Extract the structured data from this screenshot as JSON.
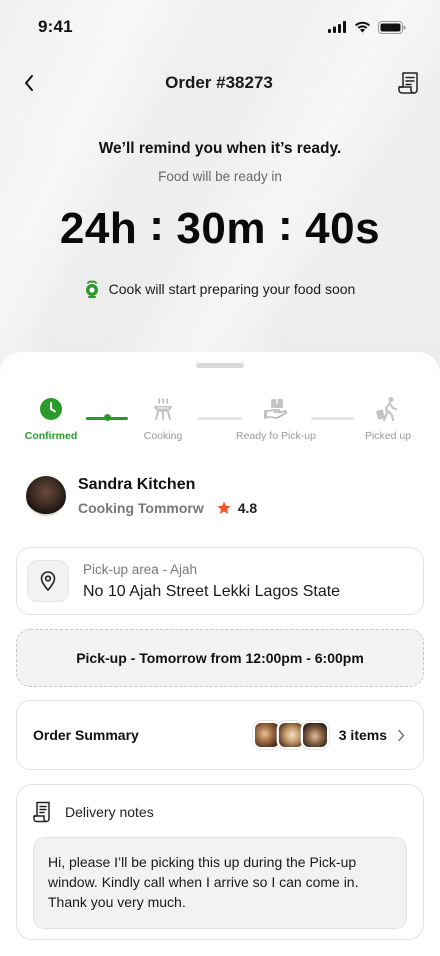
{
  "status_bar": {
    "time": "9:41"
  },
  "nav": {
    "title": "Order #38273"
  },
  "hero": {
    "remind": "We’ll remind you when it’s ready.",
    "ready_in": "Food will be ready in",
    "countdown": {
      "hours": "24h",
      "minutes": "30m",
      "seconds": "40s",
      "separator": ":"
    },
    "cook_note": "Cook will start preparing your food soon"
  },
  "stepper": {
    "steps": [
      {
        "label": "Confirmed",
        "icon": "clock-icon",
        "state": "done"
      },
      {
        "label": "Cooking",
        "icon": "grill-icon",
        "state": "pending"
      },
      {
        "label": "Ready fo Pick-up",
        "icon": "hand-package-icon",
        "state": "pending"
      },
      {
        "label": "Picked up",
        "icon": "walking-luggage-icon",
        "state": "pending"
      }
    ],
    "accent": "#2a9a2a"
  },
  "kitchen": {
    "name": "Sandra Kitchen",
    "status": "Cooking Tommorw",
    "rating": "4.8",
    "star_color": "#ee5a2a"
  },
  "pickup_area": {
    "label": "Pick-up area - Ajah",
    "address": "No 10 Ajah Street Lekki Lagos State"
  },
  "pickup_window": {
    "text": "Pick-up - Tomorrow from 12:00pm - 6:00pm"
  },
  "order_summary": {
    "title": "Order Summary",
    "items": "3 items"
  },
  "delivery_notes": {
    "title": "Delivery notes",
    "text": "Hi, please I’ll be picking this up during the Pick-up window. Kindly call when I arrive so I can come in. Thank you very much."
  }
}
